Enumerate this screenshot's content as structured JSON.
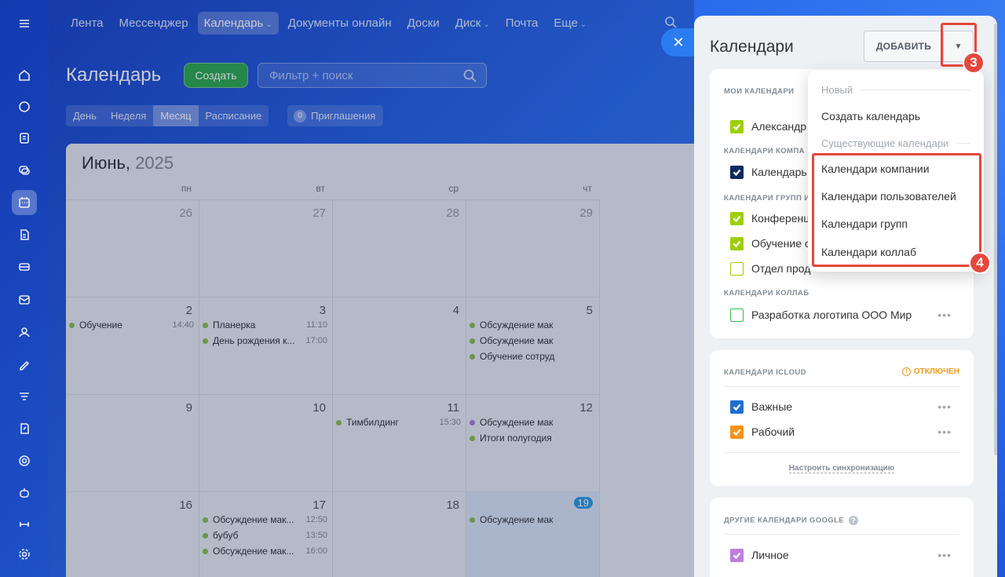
{
  "nav": {
    "items": [
      "Лента",
      "Мессенджер",
      "Календарь",
      "Документы онлайн",
      "Доски",
      "Диск",
      "Почта",
      "Еще"
    ]
  },
  "header": {
    "title": "Календарь",
    "create_label": "Создать",
    "filter_placeholder": "Фильтр + поиск",
    "view_tabs": [
      "День",
      "Неделя",
      "Месяц",
      "Расписание"
    ],
    "active_view": "Месяц",
    "invites_count": "0",
    "invites_label": "Приглашения"
  },
  "calendar": {
    "month": "Июнь,",
    "year": "2025",
    "weekdays": [
      "пн",
      "вт",
      "ср",
      "чт"
    ],
    "weeks": [
      {
        "days": [
          "26",
          "27",
          "28",
          "29"
        ],
        "events": [
          [],
          [],
          [],
          []
        ]
      },
      {
        "days": [
          "2",
          "3",
          "4",
          "5"
        ],
        "events": [
          [
            {
              "title": "Обучение",
              "time": "14:40"
            }
          ],
          [
            {
              "title": "Планерка",
              "time": "11:10"
            },
            {
              "title": "День рождения к...",
              "time": "17:00"
            }
          ],
          [],
          [
            {
              "title": "Обсуждение мак",
              "time": ""
            },
            {
              "title": "Обсуждение мак",
              "time": ""
            },
            {
              "title": "Обучение сотруд",
              "time": ""
            }
          ]
        ]
      },
      {
        "days": [
          "9",
          "10",
          "11",
          "12"
        ],
        "events": [
          [],
          [],
          [
            {
              "title": "Тимбилдинг",
              "time": "15:30"
            }
          ],
          [
            {
              "title": "Обсуждение мак",
              "time": "",
              "color": "purple"
            },
            {
              "title": "Итоги полугодия",
              "time": ""
            }
          ]
        ]
      },
      {
        "days": [
          "16",
          "17",
          "18",
          "19"
        ],
        "events": [
          [],
          [
            {
              "title": "Обсуждение мак...",
              "time": "12:50"
            },
            {
              "title": "бубуб",
              "time": "13:50"
            },
            {
              "title": "Обсуждение мак...",
              "time": "16:00"
            }
          ],
          [],
          [
            {
              "title": "Обсуждение мак",
              "time": ""
            }
          ]
        ]
      }
    ]
  },
  "panel": {
    "title": "Календари",
    "add_label": "ДОБАВИТЬ",
    "sections": {
      "my": "МОИ КАЛЕНДАРИ",
      "company": "КАЛЕНДАРИ КОМПА",
      "groups": "КАЛЕНДАРИ ГРУПП И",
      "collab": "КАЛЕНДАРИ КОЛЛАБ",
      "icloud": "КАЛЕНДАРИ ICLOUD",
      "google": "ДРУГИЕ КАЛЕНДАРИ GOOGLE"
    },
    "my_calendars": [
      {
        "name": "Александр",
        "color": "#9dcf00"
      }
    ],
    "company_calendars": [
      {
        "name": "Календарь",
        "color": "#0c2b5e"
      }
    ],
    "group_calendars": [
      {
        "name": "Конференц",
        "color": "#9dcf00",
        "checked": true
      },
      {
        "name": "Обучение с",
        "color": "#9dcf00",
        "checked": true
      },
      {
        "name": "Отдел прод",
        "color": "#9dcf00",
        "checked": false
      }
    ],
    "collab_calendars": [
      {
        "name": "Разработка логотипа ООО Мир",
        "color": "#2fc04b",
        "checked": false
      }
    ],
    "icloud_status": "ОТКЛЮЧЕН",
    "icloud_calendars": [
      {
        "name": "Важные",
        "color": "#1e6ed0"
      },
      {
        "name": "Рабочий",
        "color": "#f7931e"
      }
    ],
    "sync_link": "Настроить синхронизацию",
    "google_calendars": [
      {
        "name": "Личное",
        "color": "#c07edc"
      }
    ]
  },
  "dropdown": {
    "new_header": "Новый",
    "create_item": "Создать календарь",
    "existing_header": "Существующие календари",
    "items": [
      "Календари компании",
      "Календари пользователей",
      "Календари групп",
      "Календари коллаб"
    ]
  },
  "annotations": {
    "step3": "3",
    "step4": "4"
  },
  "colors": {
    "highlight": "#e5473d",
    "accent": "#2b7cf0"
  }
}
